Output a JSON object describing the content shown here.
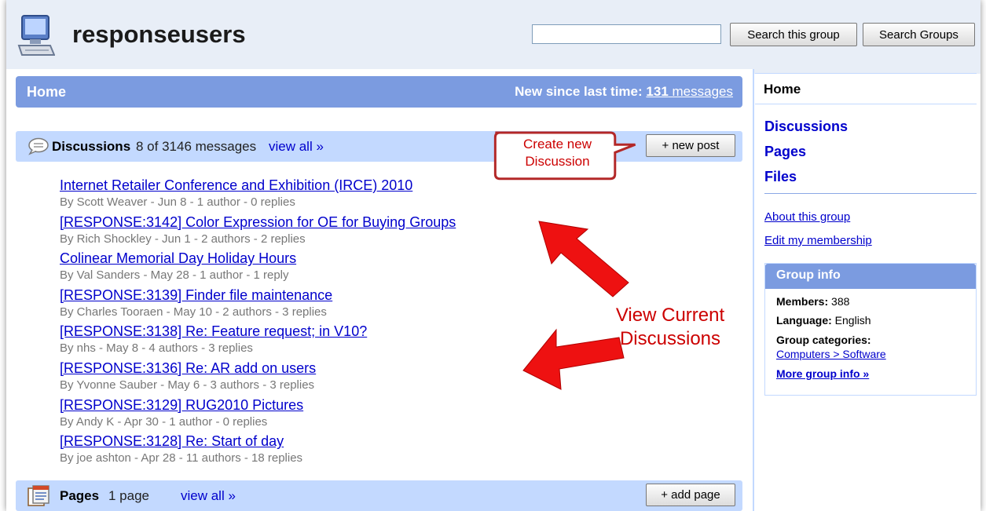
{
  "header": {
    "group_name": "responseusers",
    "search_value": "",
    "search_group_label": "Search this group",
    "search_groups_label": "Search Groups"
  },
  "home_bar": {
    "title": "Home",
    "new_since_label": "New since last time:",
    "new_count": "131",
    "new_unit": "messages"
  },
  "discussions": {
    "title": "Discussions",
    "count_text": "8 of 3146 messages",
    "view_all": "view all »",
    "new_post_label": "+ new post",
    "items": [
      {
        "title": "Internet Retailer Conference and Exhibition (IRCE) 2010",
        "meta": "By Scott Weaver - Jun 8 - 1 author - 0 replies"
      },
      {
        "title": "[RESPONSE:3142] Color Expression for OE for Buying Groups",
        "meta": "By Rich Shockley - Jun 1 - 2 authors - 2 replies"
      },
      {
        "title": "Colinear Memorial Day Holiday Hours",
        "meta": "By Val Sanders - May 28 - 1 author - 1 reply"
      },
      {
        "title": "[RESPONSE:3139] Finder file maintenance",
        "meta": "By Charles Tooraen - May 10 - 2 authors - 3 replies"
      },
      {
        "title": "[RESPONSE:3138] Re: Feature request; in V10?",
        "meta": "By nhs - May 8 - 4 authors - 3 replies"
      },
      {
        "title": "[RESPONSE:3136] Re: AR add on users",
        "meta": "By Yvonne Sauber - May 6 - 3 authors - 3 replies"
      },
      {
        "title": "[RESPONSE:3129] RUG2010 Pictures",
        "meta": "By Andy K - Apr 30 - 1 author - 0 replies"
      },
      {
        "title": "[RESPONSE:3128] Re: Start of day",
        "meta": "By joe ashton - Apr 28 - 11 authors - 18 replies"
      }
    ]
  },
  "pages": {
    "title": "Pages",
    "count_text": "1 page",
    "view_all": "view all »",
    "add_page_label": "+ add page"
  },
  "callout": {
    "line1": "Create new",
    "line2": "Discussion"
  },
  "annotation": {
    "line1": "View Current",
    "line2": "Discussions"
  },
  "sidebar": {
    "home": "Home",
    "nav": [
      "Discussions",
      "Pages",
      "Files"
    ],
    "links": [
      "About this group",
      "Edit my membership"
    ],
    "group_info": {
      "title": "Group info",
      "members_label": "Members:",
      "members_value": "388",
      "language_label": "Language:",
      "language_value": "English",
      "categories_label": "Group categories:",
      "categories_value": "Computers > Software",
      "more_link": "More group info »"
    }
  },
  "colors": {
    "header_bg": "#e8eef7",
    "bar_blue": "#7b9be0",
    "section_blue": "#c3d9ff",
    "link": "#0000cc",
    "annotation_red": "#cc0000"
  }
}
